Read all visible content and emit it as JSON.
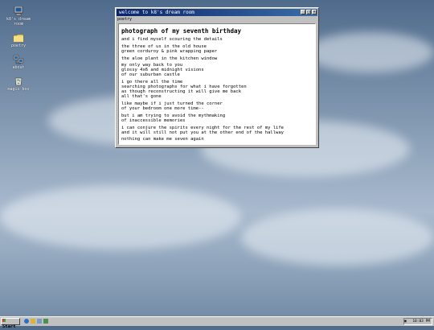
{
  "desktop": {
    "icons": [
      {
        "label": "k8's dream room",
        "icon": "computer-icon"
      },
      {
        "label": "poetry",
        "icon": "folder-icon"
      },
      {
        "label": "about",
        "icon": "network-icon"
      },
      {
        "label": "magic box",
        "icon": "recycle-bin-icon"
      }
    ]
  },
  "window": {
    "title": "welcome to k8's dream room",
    "menu": "poetry",
    "buttons": [
      "minimize",
      "maximize",
      "close"
    ],
    "poem_title": "photograph of my seventh birthday",
    "stanzas": [
      [
        "and i find myself scouring the details"
      ],
      [
        "the three of us in the old house",
        "green corduroy & pink wrapping paper"
      ],
      [
        "the aloe plant in the kitchen window"
      ],
      [
        "my only way back to you",
        "glossy 4x6 and midnight visions",
        "of our suburban castle"
      ],
      [
        "i go there all the time",
        "searching photographs for what i have forgotten",
        "as though reconstructing it will give me back",
        "all that's gone"
      ],
      [
        "like maybe if i just turned the corner",
        "of your bedroom one more time--"
      ],
      [
        "but i am trying to avoid the mythmaking",
        "of inaccessible memories"
      ],
      [
        "i can conjure the spirits every night for the rest of my life",
        "and it will still not put you at the other end of the hallway"
      ],
      [
        "nothing can make me seven again"
      ]
    ]
  },
  "taskbar": {
    "start_label": "Start",
    "clock": "10:03 PM"
  },
  "colors": {
    "titlebar": "#0a246a",
    "window_bg": "#c0c0c0",
    "content_bg": "#ffffff"
  }
}
